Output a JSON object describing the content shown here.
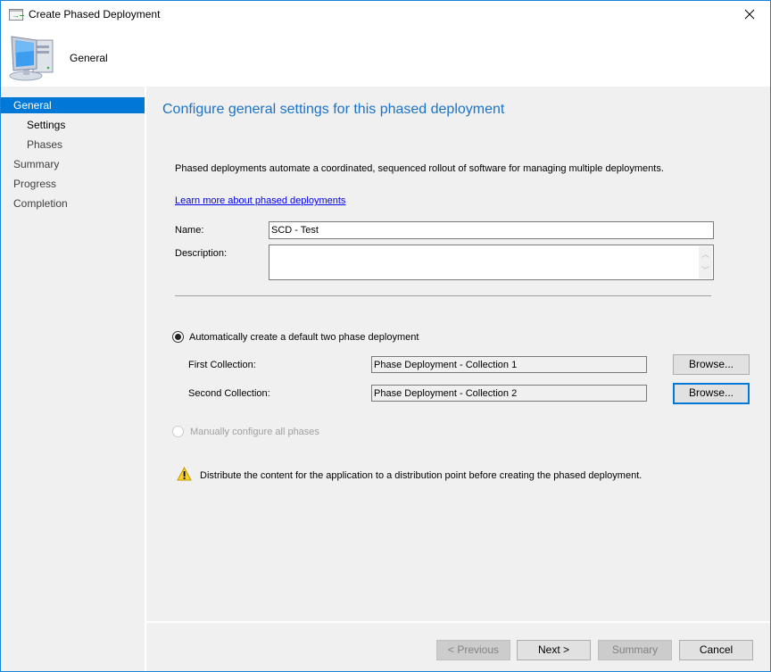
{
  "window": {
    "title": "Create Phased Deployment",
    "title_icon": "wizard-window-icon",
    "close_icon": "close-icon"
  },
  "header": {
    "icon": "computer-icon",
    "title": "General"
  },
  "sidebar": {
    "items": [
      {
        "label": "General",
        "level": 0,
        "state": "selected"
      },
      {
        "label": "Settings",
        "level": 1,
        "state": "current"
      },
      {
        "label": "Phases",
        "level": 1,
        "state": "normal"
      },
      {
        "label": "Summary",
        "level": 0,
        "state": "normal"
      },
      {
        "label": "Progress",
        "level": 0,
        "state": "normal"
      },
      {
        "label": "Completion",
        "level": 0,
        "state": "normal"
      }
    ]
  },
  "main": {
    "title": "Configure general settings for this phased deployment",
    "intro": "Phased deployments automate a coordinated, sequenced rollout of software for managing multiple deployments.",
    "learn_more_link": "Learn more about phased deployments",
    "name_label": "Name:",
    "name_value": "SCD - Test",
    "description_label": "Description:",
    "description_value": "",
    "option_auto": {
      "label": "Automatically create a default two phase deployment",
      "checked": true,
      "enabled": true
    },
    "first_collection_label": "First Collection:",
    "first_collection_value": "Phase Deployment - Collection 1",
    "second_collection_label": "Second Collection:",
    "second_collection_value": "Phase Deployment - Collection 2",
    "browse_label": "Browse...",
    "option_manual": {
      "label": "Manually configure all phases",
      "checked": false,
      "enabled": false
    },
    "warning_icon": "warning-icon",
    "warning_text": "Distribute the content for the application to a distribution point before creating the phased deployment."
  },
  "footer": {
    "previous_label": "< Previous",
    "next_label": "Next >",
    "summary_label": "Summary",
    "cancel_label": "Cancel"
  },
  "colors": {
    "accent": "#0078d7",
    "title_blue": "#1a73c8",
    "link": "#0000ee",
    "window_border": "#1883d7",
    "panel_bg": "#f0f0f0"
  }
}
